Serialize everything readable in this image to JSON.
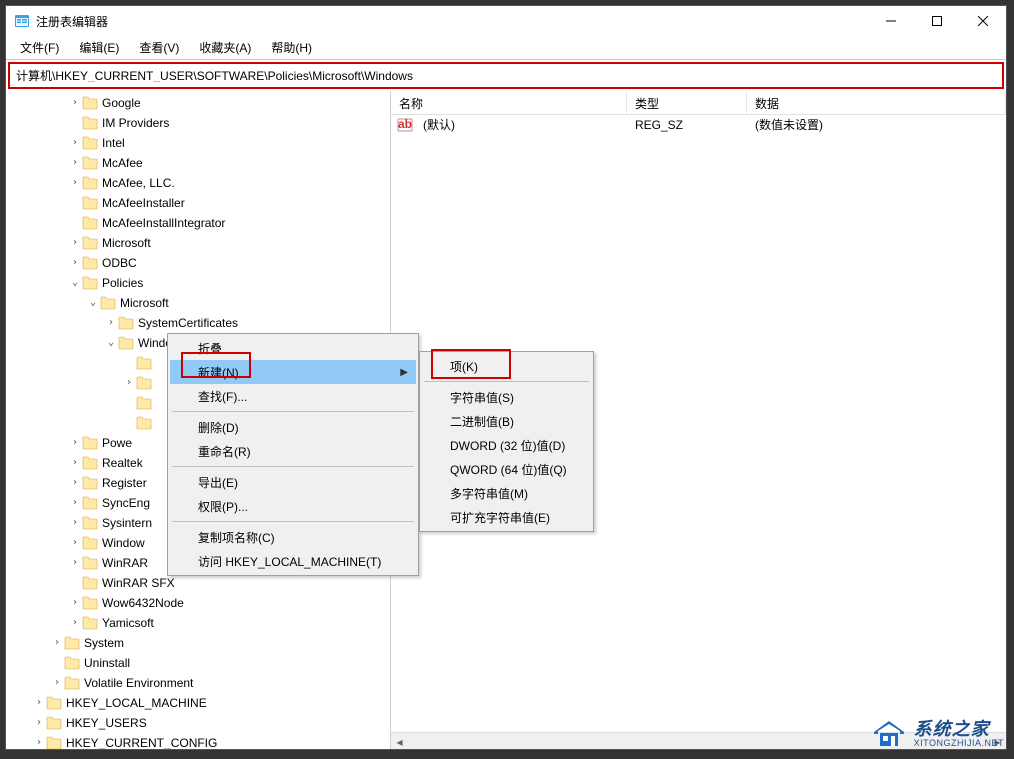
{
  "window": {
    "title": "注册表编辑器"
  },
  "menu": {
    "file": "文件(F)",
    "edit": "编辑(E)",
    "view": "查看(V)",
    "favorites": "收藏夹(A)",
    "help": "帮助(H)"
  },
  "address": "计算机\\HKEY_CURRENT_USER\\SOFTWARE\\Policies\\Microsoft\\Windows",
  "tree": [
    {
      "indent": 3,
      "exp": ">",
      "label": "Google"
    },
    {
      "indent": 3,
      "exp": "",
      "label": "IM Providers"
    },
    {
      "indent": 3,
      "exp": ">",
      "label": "Intel"
    },
    {
      "indent": 3,
      "exp": ">",
      "label": "McAfee"
    },
    {
      "indent": 3,
      "exp": ">",
      "label": "McAfee, LLC."
    },
    {
      "indent": 3,
      "exp": "",
      "label": "McAfeeInstaller"
    },
    {
      "indent": 3,
      "exp": "",
      "label": "McAfeeInstallIntegrator"
    },
    {
      "indent": 3,
      "exp": ">",
      "label": "Microsoft"
    },
    {
      "indent": 3,
      "exp": ">",
      "label": "ODBC"
    },
    {
      "indent": 3,
      "exp": "v",
      "label": "Policies"
    },
    {
      "indent": 4,
      "exp": "v",
      "label": "Microsoft"
    },
    {
      "indent": 5,
      "exp": ">",
      "label": "SystemCertificates"
    },
    {
      "indent": 5,
      "exp": "v",
      "label": "Windows"
    },
    {
      "indent": 6,
      "exp": "",
      "label": ""
    },
    {
      "indent": 6,
      "exp": ">",
      "label": ""
    },
    {
      "indent": 6,
      "exp": "",
      "label": ""
    },
    {
      "indent": 6,
      "exp": "",
      "label": ""
    },
    {
      "indent": 3,
      "exp": ">",
      "label": "Powe"
    },
    {
      "indent": 3,
      "exp": ">",
      "label": "Realtek"
    },
    {
      "indent": 3,
      "exp": ">",
      "label": "Register"
    },
    {
      "indent": 3,
      "exp": ">",
      "label": "SyncEng"
    },
    {
      "indent": 3,
      "exp": ">",
      "label": "Sysintern"
    },
    {
      "indent": 3,
      "exp": ">",
      "label": "Window"
    },
    {
      "indent": 3,
      "exp": ">",
      "label": "WinRAR"
    },
    {
      "indent": 3,
      "exp": "",
      "label": "WinRAR SFX"
    },
    {
      "indent": 3,
      "exp": ">",
      "label": "Wow6432Node"
    },
    {
      "indent": 3,
      "exp": ">",
      "label": "Yamicsoft"
    },
    {
      "indent": 2,
      "exp": ">",
      "label": "System"
    },
    {
      "indent": 2,
      "exp": "",
      "label": "Uninstall"
    },
    {
      "indent": 2,
      "exp": ">",
      "label": "Volatile Environment"
    },
    {
      "indent": 1,
      "exp": ">",
      "label": "HKEY_LOCAL_MACHINE"
    },
    {
      "indent": 1,
      "exp": ">",
      "label": "HKEY_USERS"
    },
    {
      "indent": 1,
      "exp": ">",
      "label": "HKEY_CURRENT_CONFIG"
    }
  ],
  "columns": {
    "name": "名称",
    "type": "类型",
    "data": "数据"
  },
  "rows": [
    {
      "name": "(默认)",
      "type": "REG_SZ",
      "data": "(数值未设置)"
    }
  ],
  "context1": {
    "collapse": "折叠",
    "new": "新建(N)",
    "find": "查找(F)...",
    "delete": "删除(D)",
    "rename": "重命名(R)",
    "export": "导出(E)",
    "perm": "权限(P)...",
    "copyname": "复制项名称(C)",
    "goto": "访问 HKEY_LOCAL_MACHINE(T)"
  },
  "context2": {
    "key": "项(K)",
    "string": "字符串值(S)",
    "binary": "二进制值(B)",
    "dword": "DWORD (32 位)值(D)",
    "qword": "QWORD (64 位)值(Q)",
    "multi": "多字符串值(M)",
    "expand": "可扩充字符串值(E)"
  },
  "watermark": {
    "main": "系统之家",
    "sub": "XITONGZHIJIA.NET"
  }
}
